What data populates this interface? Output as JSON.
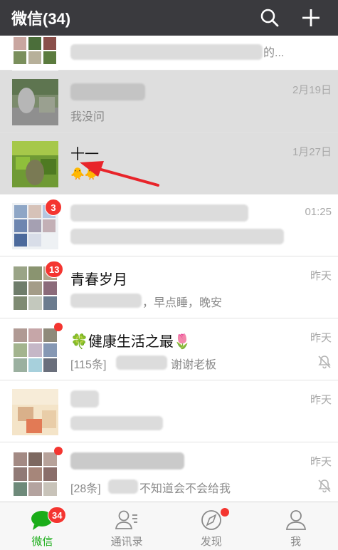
{
  "header": {
    "title": "微信(34)",
    "search_icon": "search-icon",
    "add_icon": "plus-icon"
  },
  "chats": [
    {
      "name": "",
      "preview": "的...",
      "time": ""
    },
    {
      "name": "",
      "preview": "我没问",
      "time": "2月19日"
    },
    {
      "name": "十一",
      "preview": "🐥🐥",
      "time": "1月27日"
    },
    {
      "name": "",
      "preview": "",
      "time": "01:25",
      "badge": "3"
    },
    {
      "name": "青春岁月",
      "preview": "，早点睡，晚安",
      "time": "昨天",
      "badge": "13"
    },
    {
      "name": "🍀健康生活之最🌷",
      "preview": "[115条]",
      "preview2": "谢谢老板",
      "time": "昨天",
      "muted": true
    },
    {
      "name": "",
      "preview": "",
      "time": "昨天"
    },
    {
      "name": "",
      "preview": "[28条]",
      "preview2": "不知道会不会给我",
      "time": "昨天",
      "muted": true
    }
  ],
  "tabs": [
    {
      "label": "微信",
      "badge": "34",
      "icon": "chat-bubble-icon"
    },
    {
      "label": "通讯录",
      "icon": "contacts-icon"
    },
    {
      "label": "发现",
      "icon": "compass-icon"
    },
    {
      "label": "我",
      "icon": "person-icon"
    }
  ],
  "colors": {
    "header": "#3a3a3e",
    "accent": "#1aad19",
    "badge": "#f43530",
    "arrow": "#e8242a"
  }
}
